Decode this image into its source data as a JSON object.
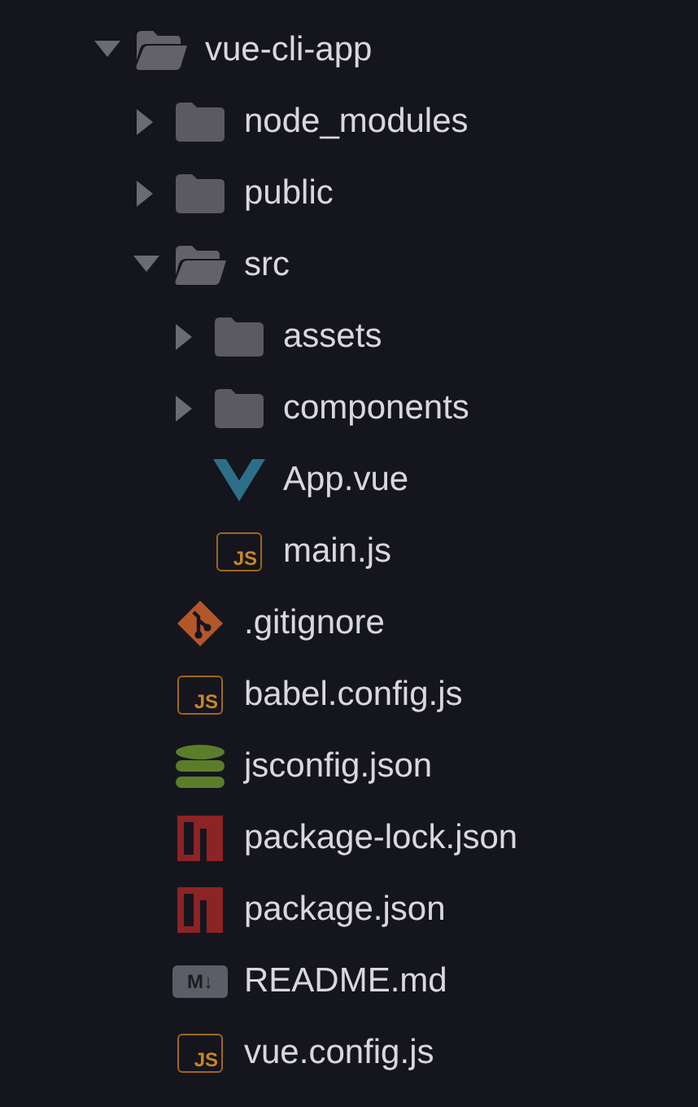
{
  "tree": [
    {
      "name": "vue-cli-app",
      "kind": "folder",
      "expanded": true,
      "children": [
        {
          "name": "node_modules",
          "kind": "folder",
          "expanded": false
        },
        {
          "name": "public",
          "kind": "folder",
          "expanded": false
        },
        {
          "name": "src",
          "kind": "folder",
          "expanded": true,
          "children": [
            {
              "name": "assets",
              "kind": "folder",
              "expanded": false
            },
            {
              "name": "components",
              "kind": "folder",
              "expanded": false
            },
            {
              "name": "App.vue",
              "kind": "vue"
            },
            {
              "name": "main.js",
              "kind": "js",
              "icon_text": "JS"
            }
          ]
        },
        {
          "name": ".gitignore",
          "kind": "git"
        },
        {
          "name": "babel.config.js",
          "kind": "js",
          "icon_text": "JS"
        },
        {
          "name": "jsconfig.json",
          "kind": "db"
        },
        {
          "name": "package-lock.json",
          "kind": "npm"
        },
        {
          "name": "package.json",
          "kind": "npm"
        },
        {
          "name": "README.md",
          "kind": "md",
          "icon_text": "M↓"
        },
        {
          "name": "vue.config.js",
          "kind": "js",
          "icon_text": "JS"
        }
      ]
    }
  ]
}
